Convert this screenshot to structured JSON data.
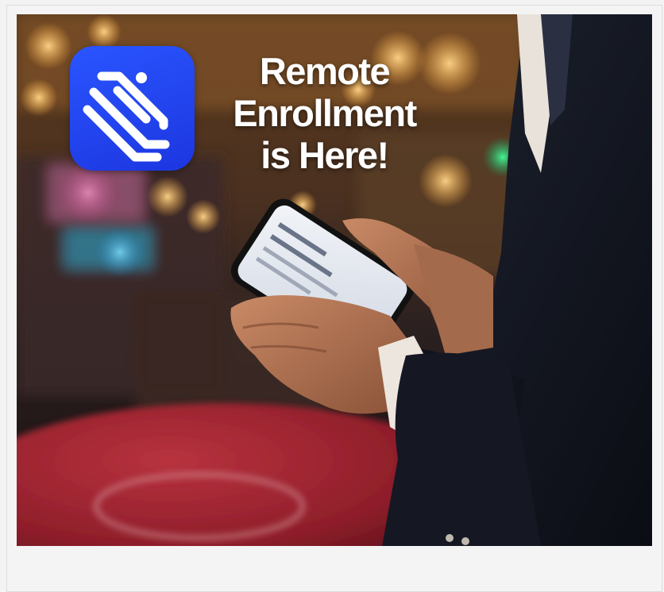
{
  "headline": {
    "line1": "Remote",
    "line2": "Enrollment",
    "line3": "is Here!"
  },
  "logo": {
    "icon": "layered-stack-icon",
    "color": "#2347F5"
  },
  "hero_image": {
    "subject": "photo-person-using-phone"
  },
  "colors": {
    "background": "#F4F4F4",
    "logo_blue": "#2347F5",
    "headline_text": "#FFFFFF",
    "table_red": "#8E1E2A"
  }
}
